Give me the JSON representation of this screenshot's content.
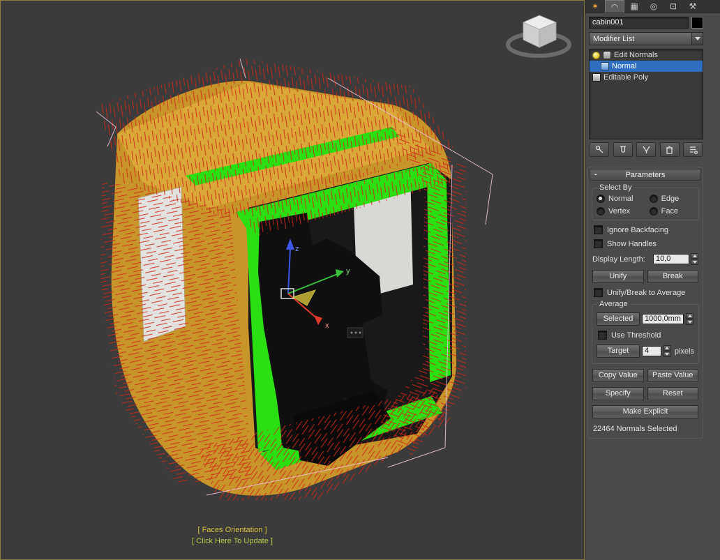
{
  "command_tabs": [
    {
      "name": "create",
      "glyph": "✶"
    },
    {
      "name": "modify",
      "glyph": "◠",
      "active": true
    },
    {
      "name": "hierarchy",
      "glyph": "▦"
    },
    {
      "name": "motion",
      "glyph": "◎"
    },
    {
      "name": "display",
      "glyph": "⊡"
    },
    {
      "name": "utilities",
      "glyph": "⚒"
    }
  ],
  "panel": {
    "object_name": "cabin001",
    "modifier_list_label": "Modifier List",
    "collapse_glyph": "-",
    "stack": [
      {
        "label": "Edit Normals"
      },
      {
        "label": "Normal",
        "selected": true
      },
      {
        "label": "Editable Poly"
      }
    ],
    "stack_toolbar_icons": [
      "pin-stack",
      "show-end-result",
      "make-unique",
      "remove-modifier",
      "configure-modifier-sets"
    ],
    "rollout_title": "Parameters",
    "select_by": {
      "label": "Select By",
      "options": [
        {
          "label": "Normal",
          "selected": true
        },
        {
          "label": "Edge",
          "selected": false
        },
        {
          "label": "Vertex",
          "selected": false
        },
        {
          "label": "Face",
          "selected": false
        }
      ]
    },
    "ignore_backfacing_label": "Ignore Backfacing",
    "show_handles_label": "Show Handles",
    "display_length": {
      "label": "Display Length:",
      "value": "10,0"
    },
    "unify_label": "Unify",
    "break_label": "Break",
    "unify_break_avg_label": "Unify/Break to Average",
    "average": {
      "label": "Average",
      "selected_button": "Selected",
      "selected_value": "1000,0mm",
      "use_threshold_label": "Use Threshold",
      "target_button": "Target",
      "target_value": "4",
      "units_label": "pixels"
    },
    "copy_value_label": "Copy Value",
    "paste_value_label": "Paste Value",
    "specify_label": "Specify",
    "reset_label": "Reset",
    "make_explicit_label": "Make Explicit",
    "status": "22464 Normals Selected"
  },
  "viewport": {
    "xview_labels": {
      "faces_orientation": "[ Faces Orientation ]",
      "click_to_update": "[ Click Here To Update ]"
    },
    "gizmo_axes": {
      "x": "x",
      "y": "y",
      "z": "z"
    },
    "colors": {
      "background": "#3b3b3b",
      "model_shell": "#c8952a",
      "selected_faces": "#2adf12",
      "normals": "#d02818",
      "selection_highlight": "#2e6fc2",
      "wireframe": "#eec4e0"
    }
  }
}
